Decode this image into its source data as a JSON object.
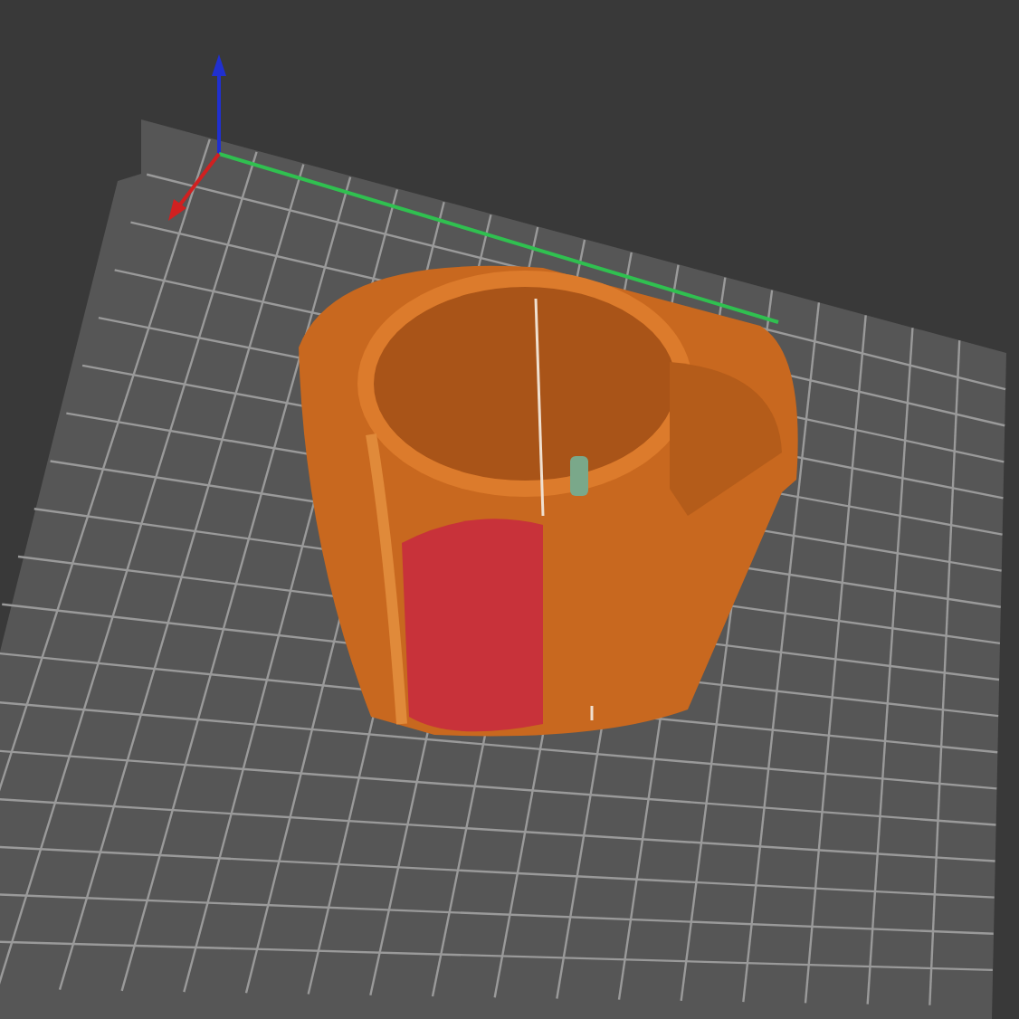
{
  "viewport": {
    "axes_visible": true,
    "grid_visible": true
  }
}
